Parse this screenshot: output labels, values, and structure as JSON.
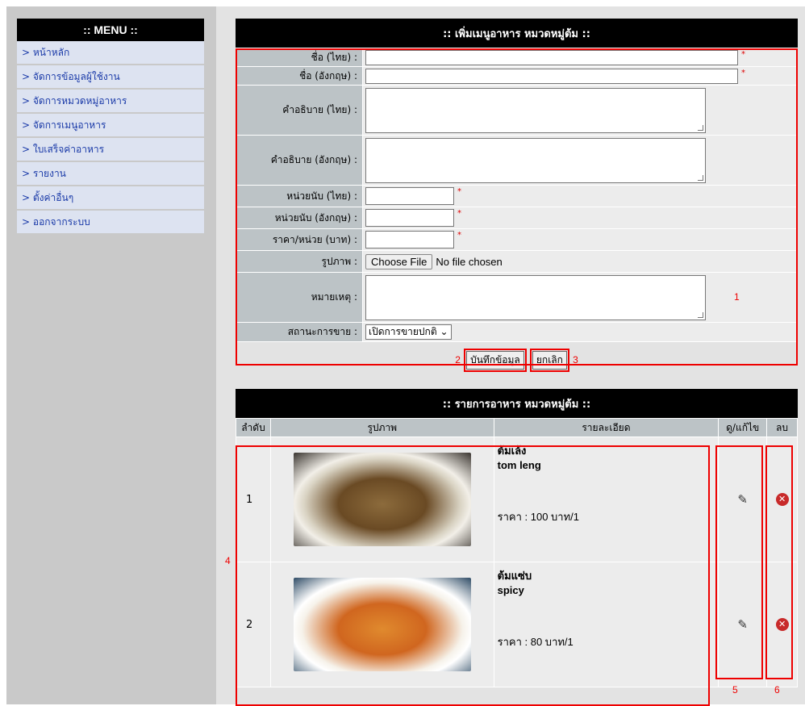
{
  "menu": {
    "title": ":: MENU ::",
    "items": [
      "> หน้าหลัก",
      "> จัดการข้อมูลผู้ใช้งาน",
      "> จัดการหมวดหมู่อาหาร",
      "> จัดการเมนูอาหาร",
      "> ใบเสร็จค่าอาหาร",
      "> รายงาน",
      "> ตั้งค่าอื่นๆ",
      "> ออกจากระบบ"
    ]
  },
  "form": {
    "title": ":: เพิ่มเมนูอาหาร หมวดหมู่ต้ม ::",
    "labels": {
      "name_th": "ชื่อ (ไทย) :",
      "name_en": "ชื่อ (อังกฤษ) :",
      "desc_th": "คำอธิบาย (ไทย) :",
      "desc_en": "คำอธิบาย (อังกฤษ) :",
      "unit_th": "หน่วยนับ (ไทย) :",
      "unit_en": "หน่วยนับ (อังกฤษ) :",
      "price": "ราคา/หน่วย (บาท) :",
      "image": "รูปภาพ :",
      "note": "หมายเหตุ :",
      "status": "สถานะการขาย :"
    },
    "required_mark": "*",
    "file_button": "Choose File",
    "file_status": "No file chosen",
    "status_value": "เปิดการขายปกติ",
    "save_button": "บันทึกข้อมูล",
    "cancel_button": "ยกเลิก"
  },
  "list": {
    "title": ":: รายการอาหาร หมวดหมู่ต้ม ::",
    "headers": [
      "ลำดับ",
      "รูปภาพ",
      "รายละเอียด",
      "ดู/แก้ไข",
      "ลบ"
    ],
    "rows": [
      {
        "no": "1",
        "name_th": "ต้มเล้ง",
        "name_en": "tom leng",
        "price": "ราคา : 100 บาท/1"
      },
      {
        "no": "2",
        "name_th": "ต้มแซ่บ",
        "name_en": "spicy",
        "price": "ราคา : 80 บาท/1"
      }
    ]
  },
  "annotations": [
    "1",
    "2",
    "3",
    "4",
    "5",
    "6"
  ],
  "colors": {
    "accent_red": "#e00000",
    "link_blue": "#1a3aa8",
    "header_black": "#000000"
  }
}
